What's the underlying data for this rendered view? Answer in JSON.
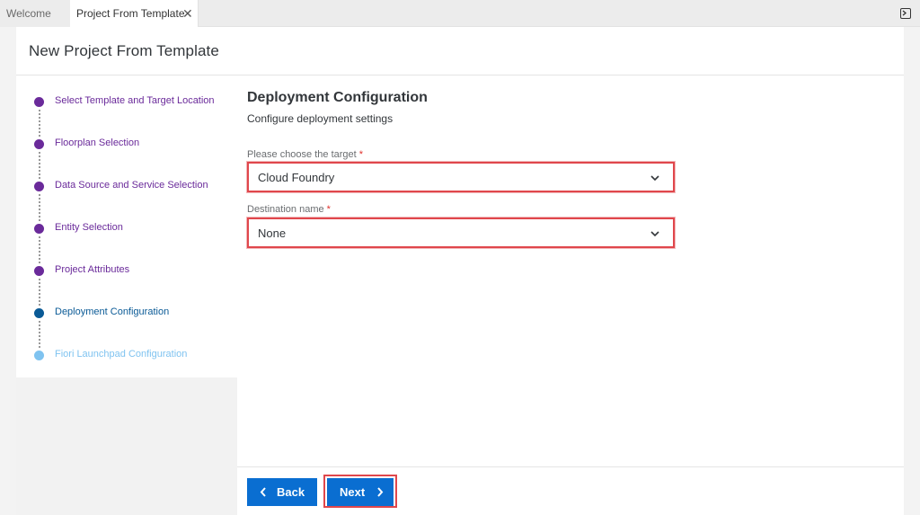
{
  "tabs": [
    {
      "label": "Welcome",
      "active": false
    },
    {
      "label": "Project From Template",
      "active": true,
      "close_icon": "close-icon"
    }
  ],
  "page": {
    "title": "New Project From Template"
  },
  "steps": [
    {
      "label": "Select Template and Target Location",
      "state": "completed"
    },
    {
      "label": "Floorplan Selection",
      "state": "completed"
    },
    {
      "label": "Data Source and Service Selection",
      "state": "completed"
    },
    {
      "label": "Entity Selection",
      "state": "completed"
    },
    {
      "label": "Project Attributes",
      "state": "completed"
    },
    {
      "label": "Deployment Configuration",
      "state": "current"
    },
    {
      "label": "Fiori Launchpad Configuration",
      "state": "upcoming"
    }
  ],
  "colors": {
    "completed": "#6a2a9a",
    "current": "#0a5a96",
    "upcoming": "#7fc3f0",
    "primary_button": "#0a6ed1",
    "highlight": "#e0474c"
  },
  "content": {
    "title": "Deployment Configuration",
    "subtitle": "Configure deployment settings",
    "target": {
      "label": "Please choose the target",
      "required_mark": "*",
      "value": "Cloud Foundry"
    },
    "destination": {
      "label": "Destination name",
      "required_mark": "*",
      "value": "None"
    }
  },
  "footer": {
    "back_label": "Back",
    "next_label": "Next"
  }
}
